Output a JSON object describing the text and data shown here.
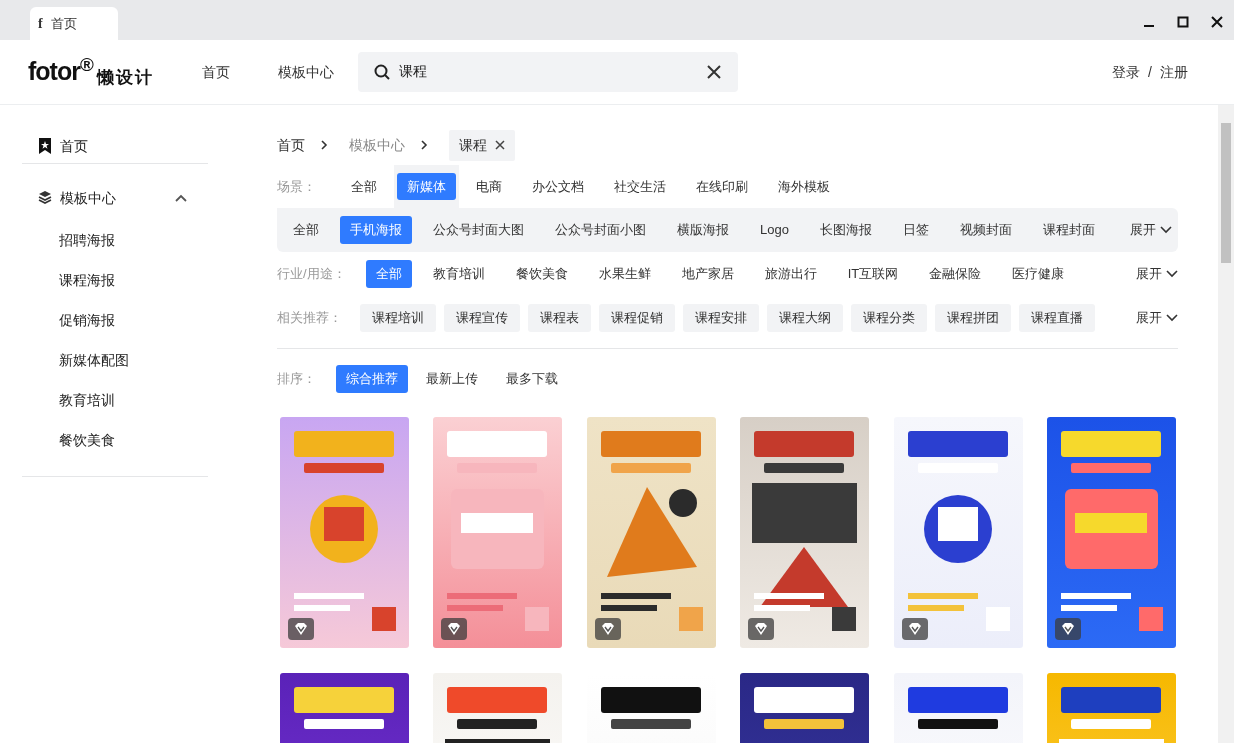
{
  "window": {
    "tab": {
      "icon": "f",
      "title": "首页"
    }
  },
  "header": {
    "logo": {
      "wordmark": "fotor",
      "mark": "®",
      "name": "懒设计"
    },
    "nav": [
      {
        "label": "首页"
      },
      {
        "label": "模板中心"
      }
    ],
    "search": {
      "value": "课程"
    },
    "auth": {
      "login": "登录",
      "separator": "/",
      "register": "注册"
    }
  },
  "sidebar": {
    "items": [
      {
        "kind": "link",
        "label": "首页"
      },
      {
        "kind": "group",
        "label": "模板中心",
        "expanded": true,
        "children": [
          {
            "label": "招聘海报"
          },
          {
            "label": "课程海报"
          },
          {
            "label": "促销海报"
          },
          {
            "label": "新媒体配图"
          },
          {
            "label": "教育培训"
          },
          {
            "label": "餐饮美食"
          }
        ]
      }
    ]
  },
  "breadcrumb": {
    "items": [
      "首页",
      "模板中心"
    ],
    "current": "课程"
  },
  "filters": {
    "scene": {
      "label": "场景：",
      "options": [
        {
          "label": "全部",
          "selected": false
        },
        {
          "label": "新媒体",
          "selected": true
        },
        {
          "label": "电商",
          "selected": false
        },
        {
          "label": "办公文档",
          "selected": false
        },
        {
          "label": "社交生活",
          "selected": false
        },
        {
          "label": "在线印刷",
          "selected": false
        },
        {
          "label": "海外模板",
          "selected": false
        }
      ]
    },
    "category": {
      "options": [
        {
          "label": "全部",
          "selected": false
        },
        {
          "label": "手机海报",
          "selected": true
        },
        {
          "label": "公众号封面大图",
          "selected": false
        },
        {
          "label": "公众号封面小图",
          "selected": false
        },
        {
          "label": "横版海报",
          "selected": false
        },
        {
          "label": "Logo",
          "selected": false
        },
        {
          "label": "长图海报",
          "selected": false
        },
        {
          "label": "日签",
          "selected": false
        },
        {
          "label": "视频封面",
          "selected": false
        },
        {
          "label": "课程封面",
          "selected": false
        }
      ],
      "expand": "展开"
    },
    "industry": {
      "label": "行业/用途：",
      "options": [
        {
          "label": "全部",
          "selected": true
        },
        {
          "label": "教育培训",
          "selected": false
        },
        {
          "label": "餐饮美食",
          "selected": false
        },
        {
          "label": "水果生鲜",
          "selected": false
        },
        {
          "label": "地产家居",
          "selected": false
        },
        {
          "label": "旅游出行",
          "selected": false
        },
        {
          "label": "IT互联网",
          "selected": false
        },
        {
          "label": "金融保险",
          "selected": false
        },
        {
          "label": "医疗健康",
          "selected": false
        }
      ],
      "expand": "展开"
    },
    "related": {
      "label": "相关推荐：",
      "tags": [
        "课程培训",
        "课程宣传",
        "课程表",
        "课程促销",
        "课程安排",
        "课程大纲",
        "课程分类",
        "课程拼团",
        "课程直播"
      ],
      "expand": "展开"
    },
    "sort": {
      "label": "排序：",
      "options": [
        {
          "label": "综合推荐",
          "selected": true
        },
        {
          "label": "最新上传",
          "selected": false
        },
        {
          "label": "最多下载",
          "selected": false
        }
      ]
    }
  },
  "templates": [
    {
      "kind": "picture",
      "vip": true
    },
    {
      "kind": "picture",
      "vip": true
    },
    {
      "kind": "picture",
      "vip": true
    },
    {
      "kind": "picture",
      "vip": true
    },
    {
      "kind": "picture",
      "vip": true
    },
    {
      "kind": "picture",
      "vip": true
    },
    {
      "kind": "picture"
    },
    {
      "kind": "picture"
    },
    {
      "kind": "picture"
    },
    {
      "kind": "picture"
    },
    {
      "kind": "picture"
    },
    {
      "kind": "picture"
    }
  ]
}
